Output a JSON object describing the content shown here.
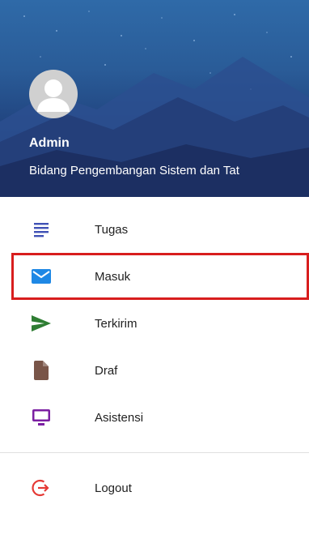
{
  "header": {
    "user_name": "Admin",
    "user_department": "Bidang Pengembangan Sistem dan Tat"
  },
  "menu": {
    "items": [
      {
        "label": "Tugas",
        "icon": "list-icon",
        "color": "#3f51b5"
      },
      {
        "label": "Masuk",
        "icon": "mail-icon",
        "color": "#1e88e5",
        "selected": true
      },
      {
        "label": "Terkirim",
        "icon": "send-icon",
        "color": "#2e7d32"
      },
      {
        "label": "Draf",
        "icon": "file-icon",
        "color": "#795548"
      },
      {
        "label": "Asistensi",
        "icon": "monitor-icon",
        "color": "#7b1fa2"
      }
    ],
    "logout": {
      "label": "Logout",
      "icon": "logout-icon",
      "color": "#e53935"
    }
  },
  "colors": {
    "selected_outline": "#d81e1e",
    "header_bg": "#2a5c98"
  }
}
